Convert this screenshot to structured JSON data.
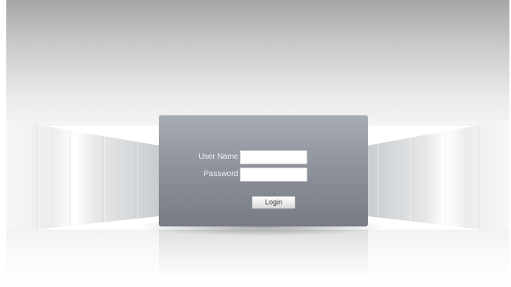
{
  "login_form": {
    "username_label": "User Name",
    "username_value": "",
    "password_label": "Password",
    "password_value": "",
    "login_button_label": "Login"
  },
  "colors": {
    "panel_top": "#a8adb5",
    "panel_bottom": "#767b84",
    "label_text": "#f2f2f2",
    "backdrop_top": "#a6a6a6"
  }
}
